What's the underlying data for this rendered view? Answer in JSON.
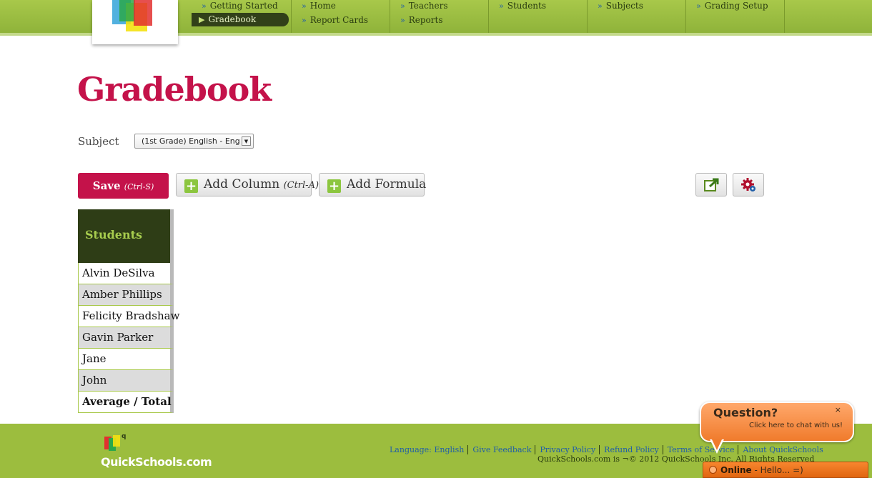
{
  "nav": {
    "columns": [
      {
        "items": [
          "Getting Started",
          "Gradebook"
        ],
        "active": 1
      },
      {
        "items": [
          "Home",
          "Report Cards"
        ]
      },
      {
        "items": [
          "Teachers",
          "Reports"
        ]
      },
      {
        "items": [
          "Students"
        ]
      },
      {
        "items": [
          "Subjects"
        ]
      },
      {
        "items": [
          "Grading Setup"
        ]
      }
    ]
  },
  "page": {
    "title": "Gradebook",
    "subject_label": "Subject",
    "subject_value": "(1st Grade) English - Eng"
  },
  "toolbar": {
    "save_label": "Save",
    "save_shortcut": "(Ctrl-S)",
    "add_column_label": "Add Column",
    "add_column_shortcut": "(Ctrl-A)",
    "add_formula_label": "Add Formula",
    "export_icon": "external-link-icon",
    "settings_icon": "gear-icon"
  },
  "students": {
    "header": "Students",
    "rows": [
      "Alvin DeSilva",
      "Amber Phillips",
      "Felicity Bradshaw",
      "Gavin Parker",
      "Jane",
      "John"
    ],
    "total_label": "Average / Total"
  },
  "footer": {
    "logo_text": "QuickSchools.com",
    "links": [
      "Language: English",
      "Give Feedback",
      "Privacy Policy",
      "Refund Policy",
      "Terms of Service",
      "About QuickSchools"
    ],
    "copyright": "QuickSchools.com is ¬© 2012 QuickSchools Inc. All Rights Reserved"
  },
  "chat": {
    "title": "Question?",
    "subtitle": "Click here to chat with us!",
    "close": "×",
    "status": "Online",
    "greeting": " - Hello... =)"
  },
  "colors": {
    "brand_green": "#9cbd3e",
    "title_red": "#c4124a",
    "dark_green": "#2e3d16",
    "chat_orange": "#f07b2c"
  }
}
